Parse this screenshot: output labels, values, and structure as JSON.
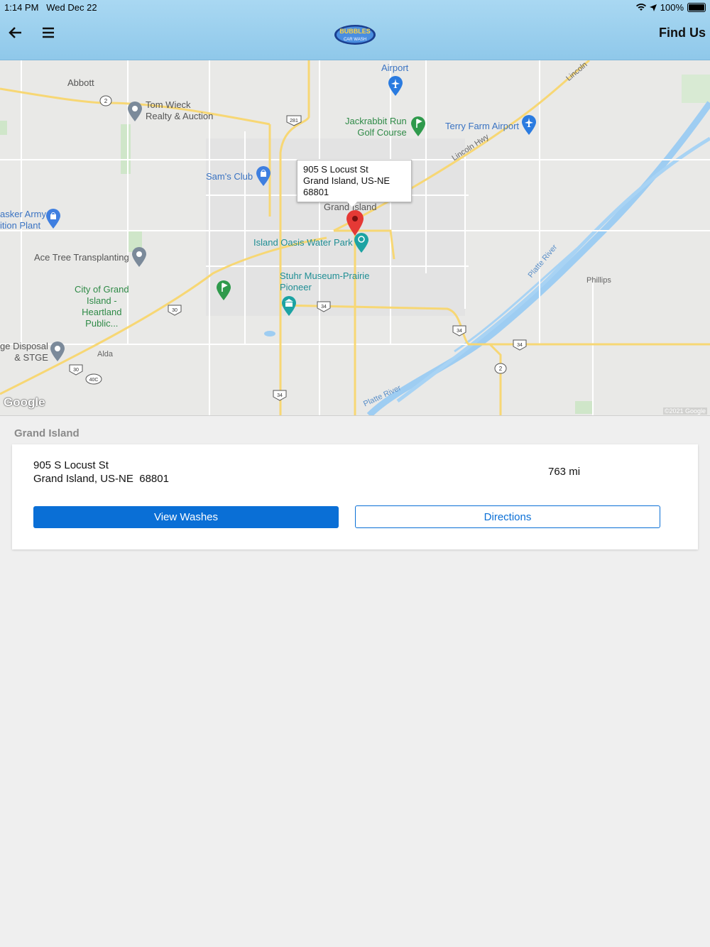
{
  "status_bar": {
    "time": "1:14 PM",
    "date": "Wed Dec 22",
    "battery": "100%"
  },
  "header": {
    "title": "Find Us",
    "logo_line1": "BUBBLES",
    "logo_line2": "CAR WASH"
  },
  "map": {
    "callout": {
      "line1": "905 S Locust St",
      "line2": "Grand Island, US-NE",
      "line3": "68801"
    },
    "labels": {
      "abbott": "Abbott",
      "airport": "Airport",
      "tom_wieck_1": "Tom Wieck",
      "tom_wieck_2": "Realty & Auction",
      "jackrabbit_1": "Jackrabbit Run",
      "jackrabbit_2": "Golf Course",
      "terry_farm": "Terry Farm Airport",
      "lincoln": "Lincoln",
      "lincoln_hwy": "Lincoln Hwy",
      "sams_club": "Sam's Club",
      "grand_island": "Grand Island",
      "husker_1": "asker Army",
      "husker_2": "ition Plant",
      "island_oasis": "Island Oasis Water Park",
      "ace_tree": "Ace Tree Transplanting",
      "stuhr_1": "Stuhr Museum-Prairie",
      "stuhr_2": "Pioneer",
      "city_1": "City of Grand",
      "city_2": "Island -",
      "city_3": "Heartland",
      "city_4": "Public...",
      "platte_river": "Platte River",
      "platte_river_2": "Platte River",
      "phillips": "Phillips",
      "disposal_1": "ge Disposal",
      "disposal_2": "& STGE",
      "alda": "Alda"
    },
    "shields": {
      "s2a": "2",
      "s281": "281",
      "s30a": "30",
      "s34a": "34",
      "s34b": "34",
      "s34c": "34",
      "s2b": "2",
      "s30b": "30",
      "s40c": "40C",
      "s34d": "34"
    },
    "google": "Google",
    "copyright": "©2021 Google"
  },
  "location": {
    "section_title": "Grand Island",
    "address_line1": "905 S Locust St",
    "address_line2": "Grand Island, US-NE  68801",
    "distance": "763 mi",
    "view_washes_label": "View Washes",
    "directions_label": "Directions"
  },
  "colors": {
    "accent": "#0a6fd6",
    "header": "#a9d8f2",
    "pin": "#e53935"
  }
}
